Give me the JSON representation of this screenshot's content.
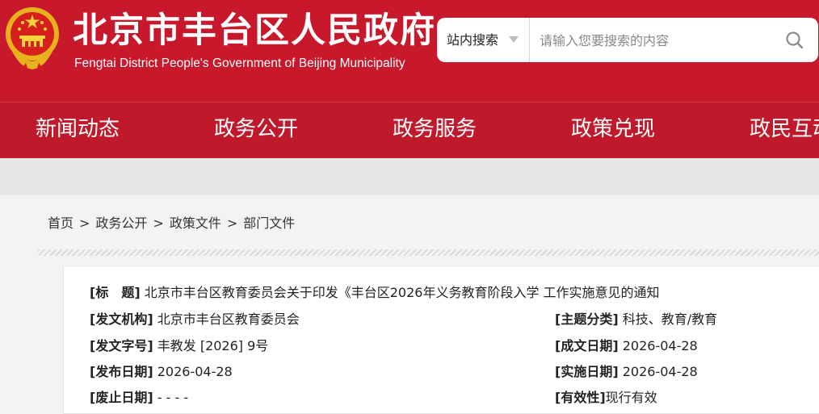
{
  "header": {
    "title_cn": "北京市丰台区人民政府",
    "title_en": "Fengtai District People's Government of Beijing Municipality",
    "brand_color": "#c8182c"
  },
  "search": {
    "scope_label": "站内搜索",
    "placeholder": "请输入您要搜索的内容"
  },
  "nav": {
    "items": [
      "新闻动态",
      "政务公开",
      "政务服务",
      "政策兑现",
      "政民互动"
    ]
  },
  "breadcrumb": {
    "items": [
      "首页",
      "政务公开",
      "政策文件",
      "部门文件"
    ],
    "separator": ">"
  },
  "doc": {
    "title_label": "[标　题]",
    "title_value": "北京市丰台区教育委员会关于印发《丰台区2026年义务教育阶段入学 工作实施意见的通知",
    "issuer_label": "[发文机构]",
    "issuer_value": "北京市丰台区教育委员会",
    "topic_label": "[主题分类]",
    "topic_value": "科技、教育/教育",
    "docno_label": "[发文字号]",
    "docno_value": "丰教发 [2026] 9号",
    "created_label": "[成文日期]",
    "created_value": "2026-04-28",
    "published_label": "[发布日期]",
    "published_value": "2026-04-28",
    "effective_label": "[实施日期]",
    "effective_value": "2026-04-28",
    "repeal_label": "[废止日期]",
    "repeal_value": "- - - -",
    "validity_label": "[有效性]",
    "validity_value": "现行有效"
  }
}
